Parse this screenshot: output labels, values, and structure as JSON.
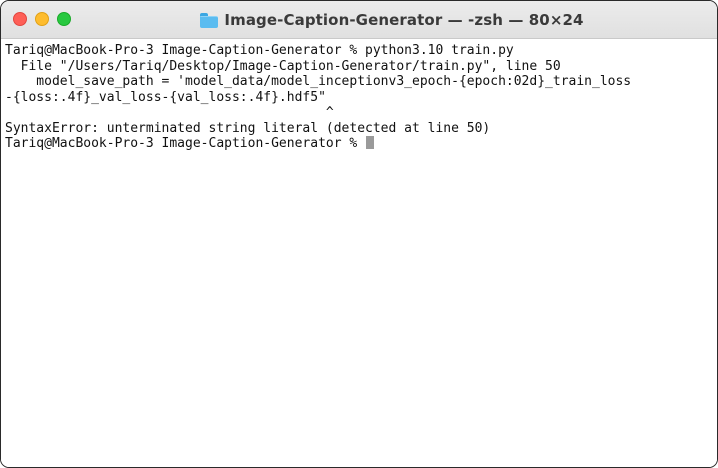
{
  "window": {
    "title": "Image-Caption-Generator — -zsh — 80×24",
    "folder_icon": "folder-icon",
    "traffic_lights": {
      "close": "#fe5f57",
      "minimize": "#febc2e",
      "zoom": "#28c840"
    }
  },
  "terminal": {
    "lines": [
      "Tariq@MacBook-Pro-3 Image-Caption-Generator % python3.10 train.py",
      "  File \"/Users/Tariq/Desktop/Image-Caption-Generator/train.py\", line 50",
      "    model_save_path = 'model_data/model_inceptionv3_epoch-{epoch:02d}_train_loss",
      "-{loss:.4f}_val_loss-{val_loss:.4f}.hdf5\"",
      "                                         ^",
      "SyntaxError: unterminated string literal (detected at line 50)"
    ],
    "prompt": "Tariq@MacBook-Pro-3 Image-Caption-Generator % "
  }
}
